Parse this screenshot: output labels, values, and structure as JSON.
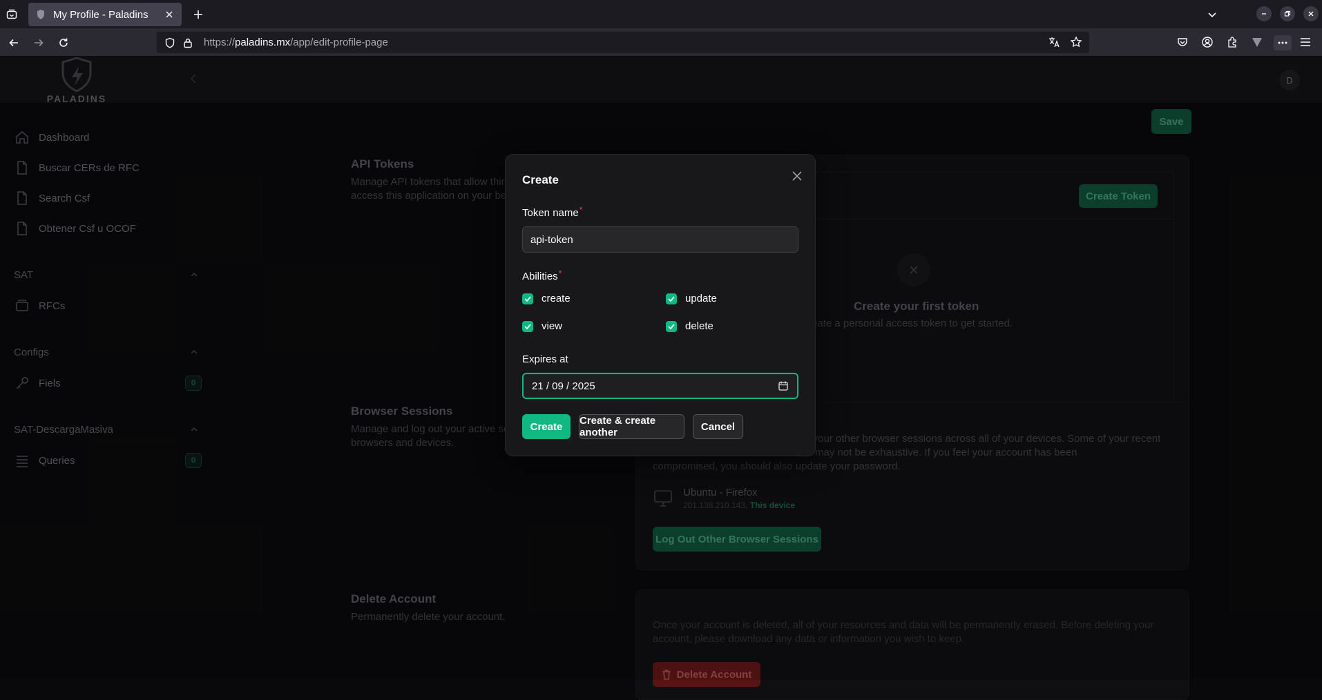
{
  "browser": {
    "tab_title": "My Profile - Paladins",
    "url_prefix": "https://",
    "url_domain": "paladins.mx",
    "url_path": "/app/edit-profile-page"
  },
  "app": {
    "logo_text": "PALADINS",
    "avatar_initial": "D",
    "save_label": "Save"
  },
  "sidebar": {
    "items": [
      {
        "label": "Dashboard",
        "icon": "home-icon"
      },
      {
        "label": "Buscar CERs de RFC",
        "icon": "document-icon"
      },
      {
        "label": "Search Csf",
        "icon": "document-icon"
      },
      {
        "label": "Obtener Csf u OCOF",
        "icon": "document-icon"
      }
    ],
    "groups": [
      {
        "label": "SAT",
        "items": [
          {
            "label": "RFCs",
            "icon": "box-icon"
          }
        ]
      },
      {
        "label": "Configs",
        "items": [
          {
            "label": "Fiels",
            "icon": "key-icon",
            "count": "0"
          }
        ]
      },
      {
        "label": "SAT-DescargaMasiva",
        "items": [
          {
            "label": "Queries",
            "icon": "list-icon",
            "count": "0"
          }
        ]
      }
    ]
  },
  "api_tokens": {
    "title": "API Tokens",
    "desc_line1": "Manage API tokens that allow thir",
    "desc_line2": "access this application on your be",
    "create_token_label": "Create Token",
    "empty_title": "Create your first token",
    "empty_sub": "reate a personal access token to get started."
  },
  "browser_sessions": {
    "title": "Browser Sessions",
    "desc_line1": "Manage and log out your active se",
    "desc_line2": "browsers and devices.",
    "text_line1": "of your other browser sessions across all of your devices. Some of your recent",
    "text_line2": "this list may not be exhaustive. If you feel your account has been",
    "text_line3": "compromised, you should also update your password.",
    "device_name": "Ubuntu - Firefox",
    "device_ip": "201.138.210.143,",
    "this_device": "This device",
    "logout_label": "Log Out Other Browser Sessions"
  },
  "delete_account": {
    "title": "Delete Account",
    "desc": "Permanently delete your account.",
    "text_line1": "Once your account is deleted, all of your resources and data will be permanently erased. Before deleting your",
    "text_line2": "account, please download any data or information you wish to keep.",
    "button_label": "Delete Account"
  },
  "modal": {
    "title": "Create",
    "token_name_label": "Token name",
    "token_name_value": "api-token",
    "abilities_label": "Abilities",
    "abilities": [
      {
        "label": "create",
        "checked": true
      },
      {
        "label": "update",
        "checked": true
      },
      {
        "label": "view",
        "checked": true
      },
      {
        "label": "delete",
        "checked": true
      }
    ],
    "expires_label": "Expires at",
    "expires_value": "21 / 09 / 2025",
    "create_label": "Create",
    "create_another_label": "Create & create another",
    "cancel_label": "Cancel"
  },
  "colors": {
    "accent": "#10b981",
    "required": "#f43f5e"
  }
}
